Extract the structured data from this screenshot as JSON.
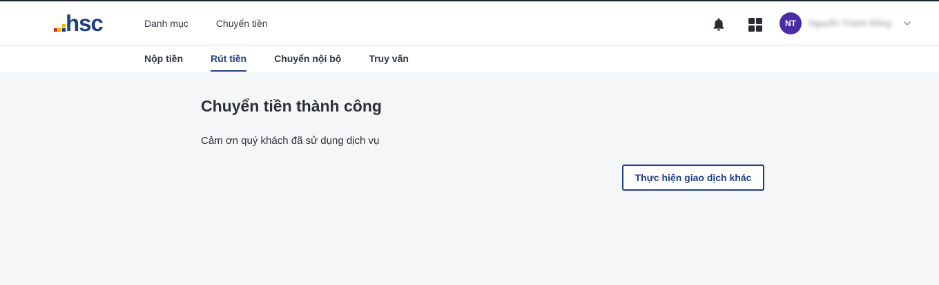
{
  "brand": {
    "logo_text": "hsc",
    "colors": {
      "primary": "#1f3f82",
      "dot_red": "#e0251b",
      "dot_yellow": "#f3b900",
      "dot_dark": "#1f3f82",
      "avatar_bg": "#4b2ca5"
    }
  },
  "header": {
    "nav": [
      {
        "label": "Danh mục"
      },
      {
        "label": "Chuyển tiền"
      }
    ],
    "icons": {
      "notifications": "bell-icon",
      "apps": "grid-icon",
      "menu": "chevron-down-icon"
    },
    "user": {
      "initials": "NT",
      "name": "Nguyễn Thành Đồng"
    }
  },
  "subnav": {
    "tabs": [
      {
        "label": "Nộp tiền",
        "active": false
      },
      {
        "label": "Rút tiền",
        "active": true
      },
      {
        "label": "Chuyển nội bộ",
        "active": false
      },
      {
        "label": "Truy vấn",
        "active": false
      }
    ]
  },
  "main": {
    "title": "Chuyển tiền thành công",
    "message": "Cảm ơn quý khách đã sử dụng dịch vụ",
    "action_label": "Thực hiện giao dịch khác"
  }
}
